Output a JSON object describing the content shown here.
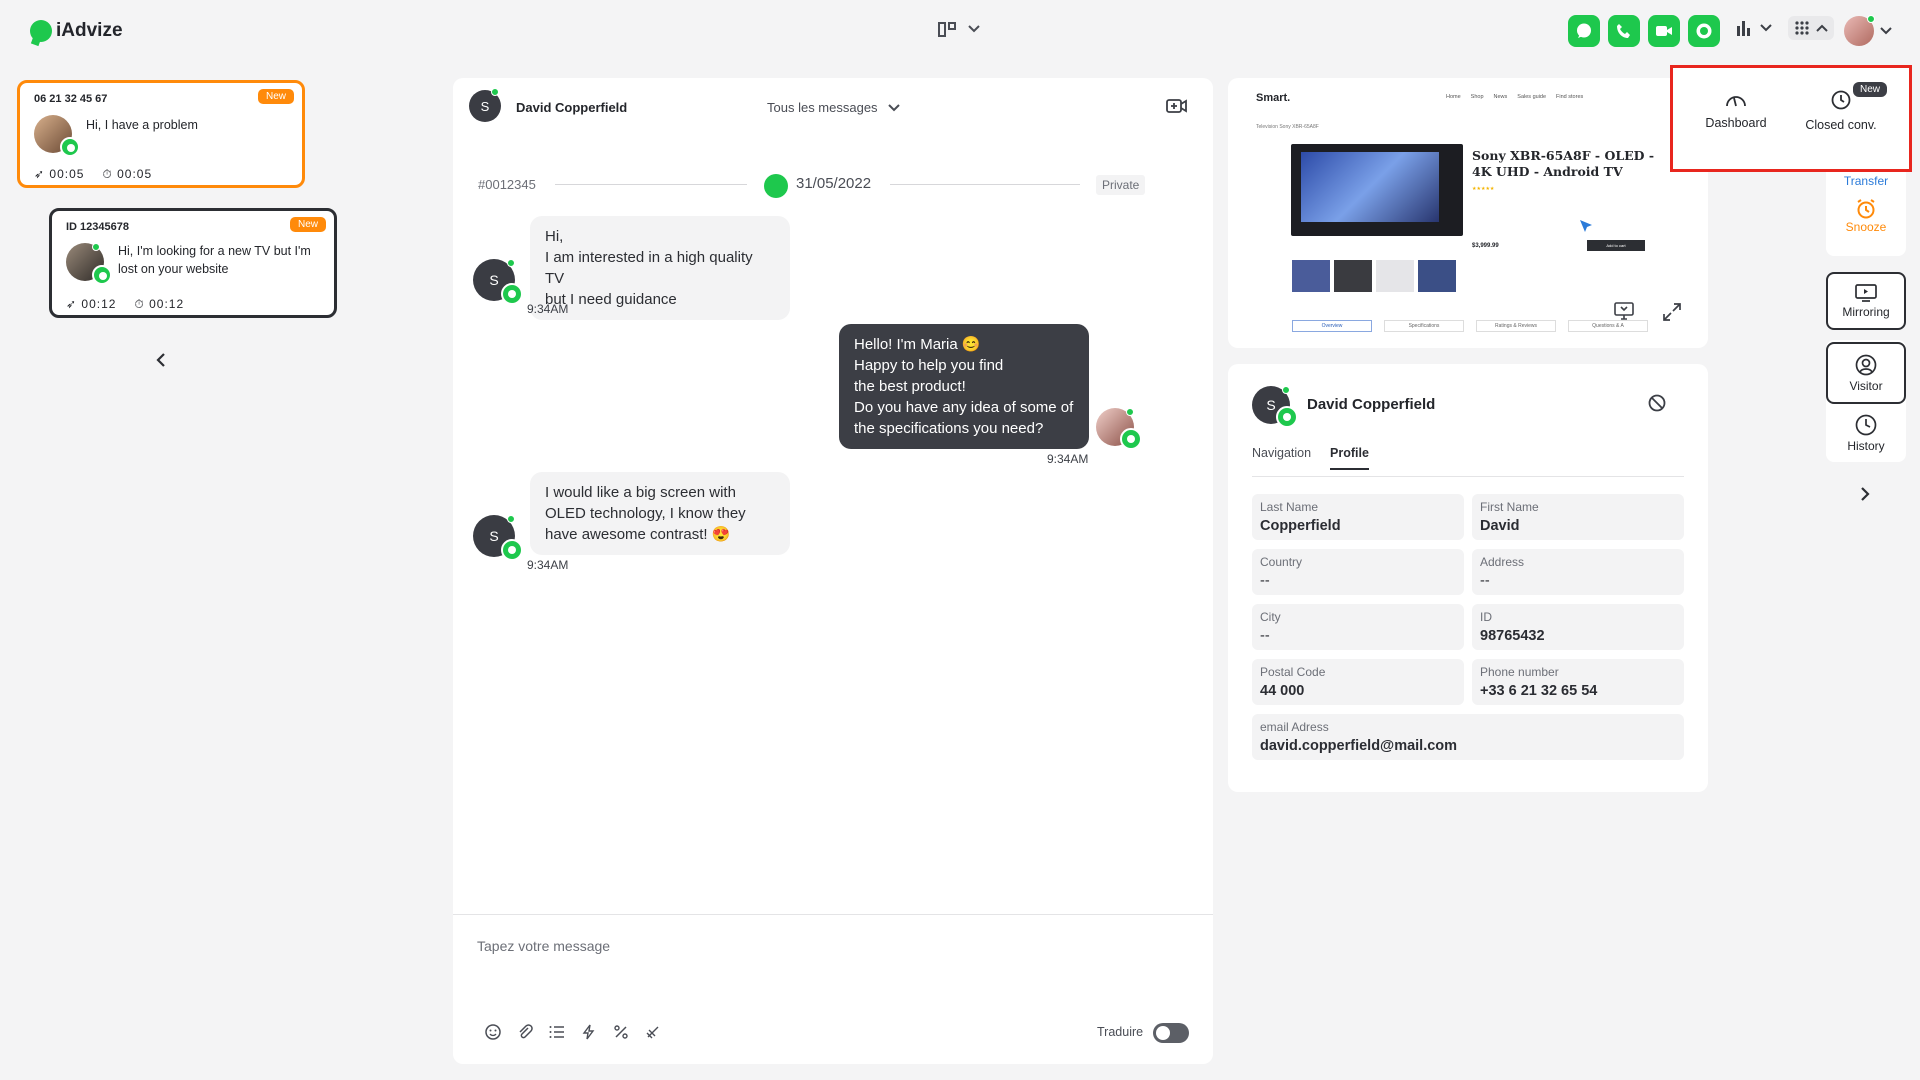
{
  "app": {
    "brand": "iAdvize"
  },
  "topbar": {
    "channels": [
      "chat-icon",
      "phone-icon",
      "video-icon",
      "messaging-icon"
    ]
  },
  "conversations": [
    {
      "id": "06 21 32 45 67",
      "badge": "New",
      "message": "Hi, I have a problem",
      "wait": "00:05",
      "duration": "00:05",
      "selected": true
    },
    {
      "id": "ID 12345678",
      "badge": "New",
      "message": "Hi, I'm looking for a new TV but I'm lost on your website",
      "wait": "00:12",
      "duration": "00:12",
      "selected": false
    }
  ],
  "chat": {
    "avatar_letter": "S",
    "visitor_name": "David Copperfield",
    "filter_label": "Tous les messages",
    "conversation_id": "#0012345",
    "date": "31/05/2022",
    "visibility": "Private",
    "messages": [
      {
        "from": "visitor",
        "lines": [
          "Hi,",
          "I am interested in a high quality TV",
          "but I need guidance"
        ],
        "time": "9:34AM"
      },
      {
        "from": "agent",
        "lines": [
          "Hello! I'm Maria 😊",
          "Happy to help you find",
          "the best product!",
          "Do you have any idea of some of",
          "the specifications you need?"
        ],
        "time": "9:34AM"
      },
      {
        "from": "visitor",
        "lines": [
          "I would like a big screen with",
          "OLED technology, I know they",
          "have awesome contrast! 😍"
        ],
        "time": "9:34AM"
      }
    ],
    "composer_placeholder": "Tapez votre message",
    "translate_label": "Traduire",
    "composer_tools": [
      "emoji-icon",
      "attachment-icon",
      "list-icon",
      "bolt-icon",
      "percent-icon",
      "no-ai-icon"
    ]
  },
  "preview": {
    "site_logo": "Smart.",
    "nav": [
      "Home",
      "Shop",
      "News",
      "Sales guide",
      "Find stores"
    ],
    "breadcrumb": "Television  Sony XBR-65A8F",
    "product_title": "Sony XBR-65A8F - OLED - 4K UHD - Android TV",
    "price": "$3,999.99",
    "add_to_cart": "Add to cart",
    "tabs": [
      "Overview",
      "Specifications",
      "Ratings & Reviews",
      "Questions & A"
    ]
  },
  "profile": {
    "avatar_letter": "S",
    "name": "David Copperfield",
    "tabs": [
      "Navigation",
      "Profile"
    ],
    "active_tab": "Profile",
    "fields": {
      "last_name": {
        "label": "Last Name",
        "value": "Copperfield"
      },
      "first_name": {
        "label": "First Name",
        "value": "David"
      },
      "country": {
        "label": "Country",
        "value": "--"
      },
      "address": {
        "label": "Address",
        "value": "--"
      },
      "city": {
        "label": "City",
        "value": "--"
      },
      "id": {
        "label": "ID",
        "value": "98765432"
      },
      "postal_code": {
        "label": "Postal Code",
        "value": "44 000"
      },
      "phone": {
        "label": "Phone number",
        "value": "+33 6 21 32 65 54"
      },
      "email": {
        "label": "email Adress",
        "value": "david.copperfield@mail.com"
      }
    }
  },
  "sidebar": {
    "transfer": "Transfer",
    "snooze": "Snooze",
    "mirroring": "Mirroring",
    "visitor": "Visitor",
    "history": "History"
  },
  "apps_menu": {
    "dashboard": "Dashboard",
    "closed": "Closed conv.",
    "closed_badge": "New"
  },
  "colors": {
    "brand_green": "#1ec84d",
    "orange": "#ff8a0a",
    "highlight_red": "#e8261e",
    "dark": "#3c3e45"
  }
}
